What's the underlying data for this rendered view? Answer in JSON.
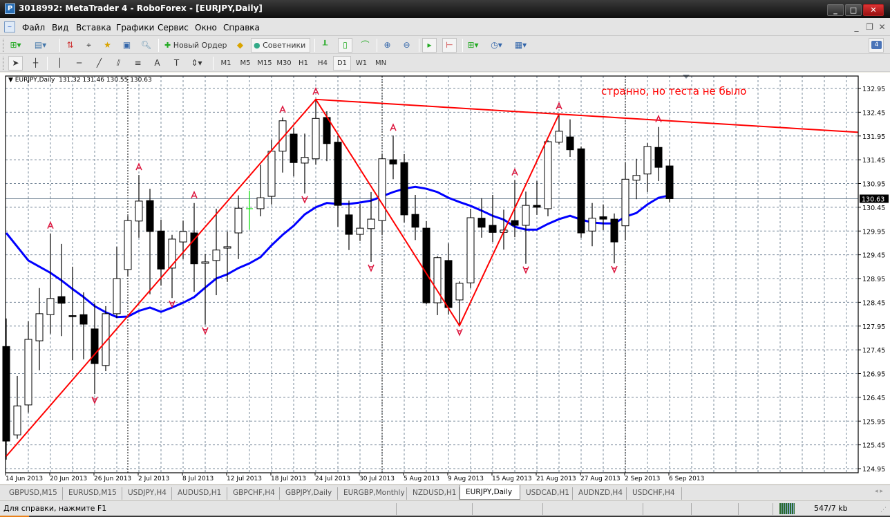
{
  "window": {
    "title": "3018992: MetaTrader 4 - RoboForex - [EURJPY,Daily]"
  },
  "menu": [
    "Файл",
    "Вид",
    "Вставка",
    "Графики",
    "Сервис",
    "Окно",
    "Справка"
  ],
  "toolbar1": {
    "new_order": "Новый Ордер",
    "experts": "Советники",
    "notification_count": "4"
  },
  "timeframes": [
    "M1",
    "M5",
    "M15",
    "M30",
    "H1",
    "H4",
    "D1",
    "W1",
    "MN"
  ],
  "active_timeframe": "D1",
  "chart_header": {
    "symbol": "EURJPY,Daily",
    "open": "131.32",
    "high": "131.46",
    "low": "130.55",
    "close": "130.63"
  },
  "tabs": [
    "GBPUSD,M15",
    "EURUSD,M15",
    "USDJPY,H4",
    "AUDUSD,H1",
    "GBPCHF,H4",
    "GBPJPY,Daily",
    "EURGBP,Monthly",
    "NZDUSD,H1",
    "EURJPY,Daily",
    "USDCAD,H1",
    "AUDNZD,H4",
    "USDCHF,H4"
  ],
  "active_tab": 8,
  "status": {
    "help": "Для справки, нажмите F1",
    "traffic": "547/7 kb"
  },
  "colors": {
    "bull": "#ffffff",
    "bear": "#000000",
    "ma": "#0000ff",
    "zigzag": "#ff0000",
    "fractal": "#dc143c",
    "special_bar": "#00dd00",
    "grid": "#778899"
  },
  "chart_data": {
    "type": "candlestick",
    "title": "EURJPY,Daily",
    "ylim": [
      124.95,
      132.95
    ],
    "yticks": [
      "132.95",
      "132.45",
      "131.95",
      "131.45",
      "130.95",
      "130.45",
      "129.95",
      "129.45",
      "128.95",
      "128.45",
      "127.95",
      "127.45",
      "126.95",
      "126.45",
      "125.95",
      "125.45",
      "124.95"
    ],
    "current_price": "130.63",
    "xlabels": [
      {
        "bar": 0,
        "label": "14 Jun 2013"
      },
      {
        "bar": 4,
        "label": "20 Jun 2013"
      },
      {
        "bar": 8,
        "label": "26 Jun 2013"
      },
      {
        "bar": 12,
        "label": "2 Jul 2013"
      },
      {
        "bar": 16,
        "label": "8 Jul 2013"
      },
      {
        "bar": 20,
        "label": "12 Jul 2013"
      },
      {
        "bar": 24,
        "label": "18 Jul 2013"
      },
      {
        "bar": 28,
        "label": "24 Jul 2013"
      },
      {
        "bar": 32,
        "label": "30 Jul 2013"
      },
      {
        "bar": 36,
        "label": "5 Aug 2013"
      },
      {
        "bar": 40,
        "label": "9 Aug 2013"
      },
      {
        "bar": 44,
        "label": "15 Aug 2013"
      },
      {
        "bar": 48,
        "label": "21 Aug 2013"
      },
      {
        "bar": 52,
        "label": "27 Aug 2013"
      },
      {
        "bar": 56,
        "label": "2 Sep 2013"
      },
      {
        "bar": 60,
        "label": "6 Sep 2013"
      }
    ],
    "period_separators": [
      11,
      34,
      56
    ],
    "ohlc": [
      [
        127.52,
        128.11,
        125.14,
        125.53
      ],
      [
        125.66,
        126.9,
        125.58,
        126.27
      ],
      [
        126.29,
        128.05,
        126.13,
        127.67
      ],
      [
        127.64,
        128.75,
        127.02,
        128.21
      ],
      [
        128.19,
        129.9,
        127.79,
        128.53
      ],
      [
        128.57,
        129.68,
        127.74,
        128.43
      ],
      [
        128.17,
        129.2,
        127.23,
        128.16
      ],
      [
        128.19,
        128.66,
        127.25,
        127.99
      ],
      [
        127.89,
        128.43,
        126.52,
        127.16
      ],
      [
        127.12,
        128.37,
        127.0,
        128.21
      ],
      [
        128.21,
        129.62,
        128.12,
        128.95
      ],
      [
        129.14,
        130.27,
        128.99,
        130.17
      ],
      [
        130.16,
        131.13,
        129.81,
        130.58
      ],
      [
        130.59,
        130.84,
        128.62,
        129.94
      ],
      [
        129.95,
        130.19,
        128.8,
        129.15
      ],
      [
        129.17,
        129.87,
        128.54,
        129.78
      ],
      [
        129.72,
        130.17,
        129.36,
        129.94
      ],
      [
        129.91,
        130.54,
        128.67,
        129.26
      ],
      [
        129.27,
        129.47,
        127.98,
        129.3
      ],
      [
        129.33,
        130.42,
        128.6,
        129.55
      ],
      [
        129.59,
        129.94,
        128.88,
        129.62
      ],
      [
        129.91,
        130.7,
        129.36,
        130.43
      ],
      [
        130.42,
        130.8,
        129.98,
        130.42
      ],
      [
        130.42,
        131.34,
        130.26,
        130.65
      ],
      [
        130.68,
        131.87,
        130.51,
        131.63
      ],
      [
        131.63,
        132.34,
        131.18,
        132.27
      ],
      [
        131.99,
        132.12,
        131.1,
        131.39
      ],
      [
        131.38,
        132.0,
        130.74,
        131.5
      ],
      [
        131.47,
        132.72,
        131.35,
        132.32
      ],
      [
        132.34,
        132.47,
        131.42,
        131.79
      ],
      [
        131.82,
        131.95,
        130.04,
        130.49
      ],
      [
        130.29,
        130.59,
        129.55,
        129.88
      ],
      [
        129.88,
        130.52,
        129.74,
        130.01
      ],
      [
        130.0,
        130.77,
        129.3,
        130.2
      ],
      [
        130.17,
        131.57,
        129.87,
        131.47
      ],
      [
        131.45,
        131.96,
        131.04,
        131.36
      ],
      [
        131.39,
        131.57,
        130.13,
        130.29
      ],
      [
        130.3,
        130.71,
        129.76,
        130.03
      ],
      [
        130.01,
        130.16,
        128.41,
        128.44
      ],
      [
        128.44,
        129.42,
        128.18,
        129.39
      ],
      [
        129.33,
        129.69,
        128.19,
        128.34
      ],
      [
        128.5,
        128.89,
        127.95,
        128.85
      ],
      [
        128.86,
        130.42,
        128.75,
        130.23
      ],
      [
        130.22,
        130.64,
        129.81,
        130.03
      ],
      [
        130.07,
        130.71,
        129.72,
        129.92
      ],
      [
        129.92,
        130.4,
        129.56,
        129.97
      ],
      [
        130.17,
        131.02,
        129.82,
        130.07
      ],
      [
        130.07,
        130.78,
        129.26,
        130.49
      ],
      [
        130.49,
        131.0,
        130.29,
        130.45
      ],
      [
        130.42,
        131.86,
        130.26,
        131.83
      ],
      [
        131.82,
        132.41,
        131.77,
        132.05
      ],
      [
        131.93,
        132.3,
        131.51,
        131.66
      ],
      [
        131.68,
        131.73,
        129.81,
        129.91
      ],
      [
        129.95,
        130.54,
        129.63,
        130.22
      ],
      [
        130.25,
        130.51,
        129.97,
        130.2
      ],
      [
        130.2,
        130.32,
        129.27,
        129.72
      ],
      [
        130.06,
        131.38,
        129.76,
        131.04
      ],
      [
        131.02,
        131.47,
        130.62,
        131.12
      ],
      [
        131.15,
        131.8,
        130.77,
        131.73
      ],
      [
        131.71,
        132.14,
        131.0,
        131.29
      ],
      [
        131.32,
        131.46,
        130.55,
        130.63
      ]
    ],
    "highlight_bars": [
      22
    ],
    "ma": [
      129.91,
      129.62,
      129.33,
      129.2,
      129.07,
      128.91,
      128.73,
      128.56,
      128.37,
      128.24,
      128.14,
      128.15,
      128.27,
      128.34,
      128.25,
      128.34,
      128.44,
      128.56,
      128.76,
      128.95,
      129.04,
      129.17,
      129.27,
      129.4,
      129.65,
      129.87,
      130.06,
      130.3,
      130.45,
      130.54,
      130.52,
      130.52,
      130.55,
      130.59,
      130.68,
      130.77,
      130.84,
      130.88,
      130.84,
      130.77,
      130.65,
      130.56,
      130.48,
      130.38,
      130.27,
      130.19,
      130.04,
      129.98,
      129.98,
      130.1,
      130.2,
      130.27,
      130.19,
      130.13,
      130.11,
      130.11,
      130.25,
      130.33,
      130.51,
      130.65,
      130.7
    ],
    "zigzag": [
      [
        0,
        125.21
      ],
      [
        28,
        132.72
      ],
      [
        41,
        127.96
      ],
      [
        50,
        132.41
      ]
    ],
    "trendline": [
      [
        28,
        132.72
      ],
      [
        50,
        132.41
      ]
    ],
    "fractals_up": [
      4,
      12,
      17,
      25,
      28,
      35,
      46,
      50,
      59
    ],
    "fractals_down": [
      8,
      15,
      18,
      27,
      33,
      41,
      47,
      55
    ],
    "annotation": "странно, но теста не было"
  }
}
